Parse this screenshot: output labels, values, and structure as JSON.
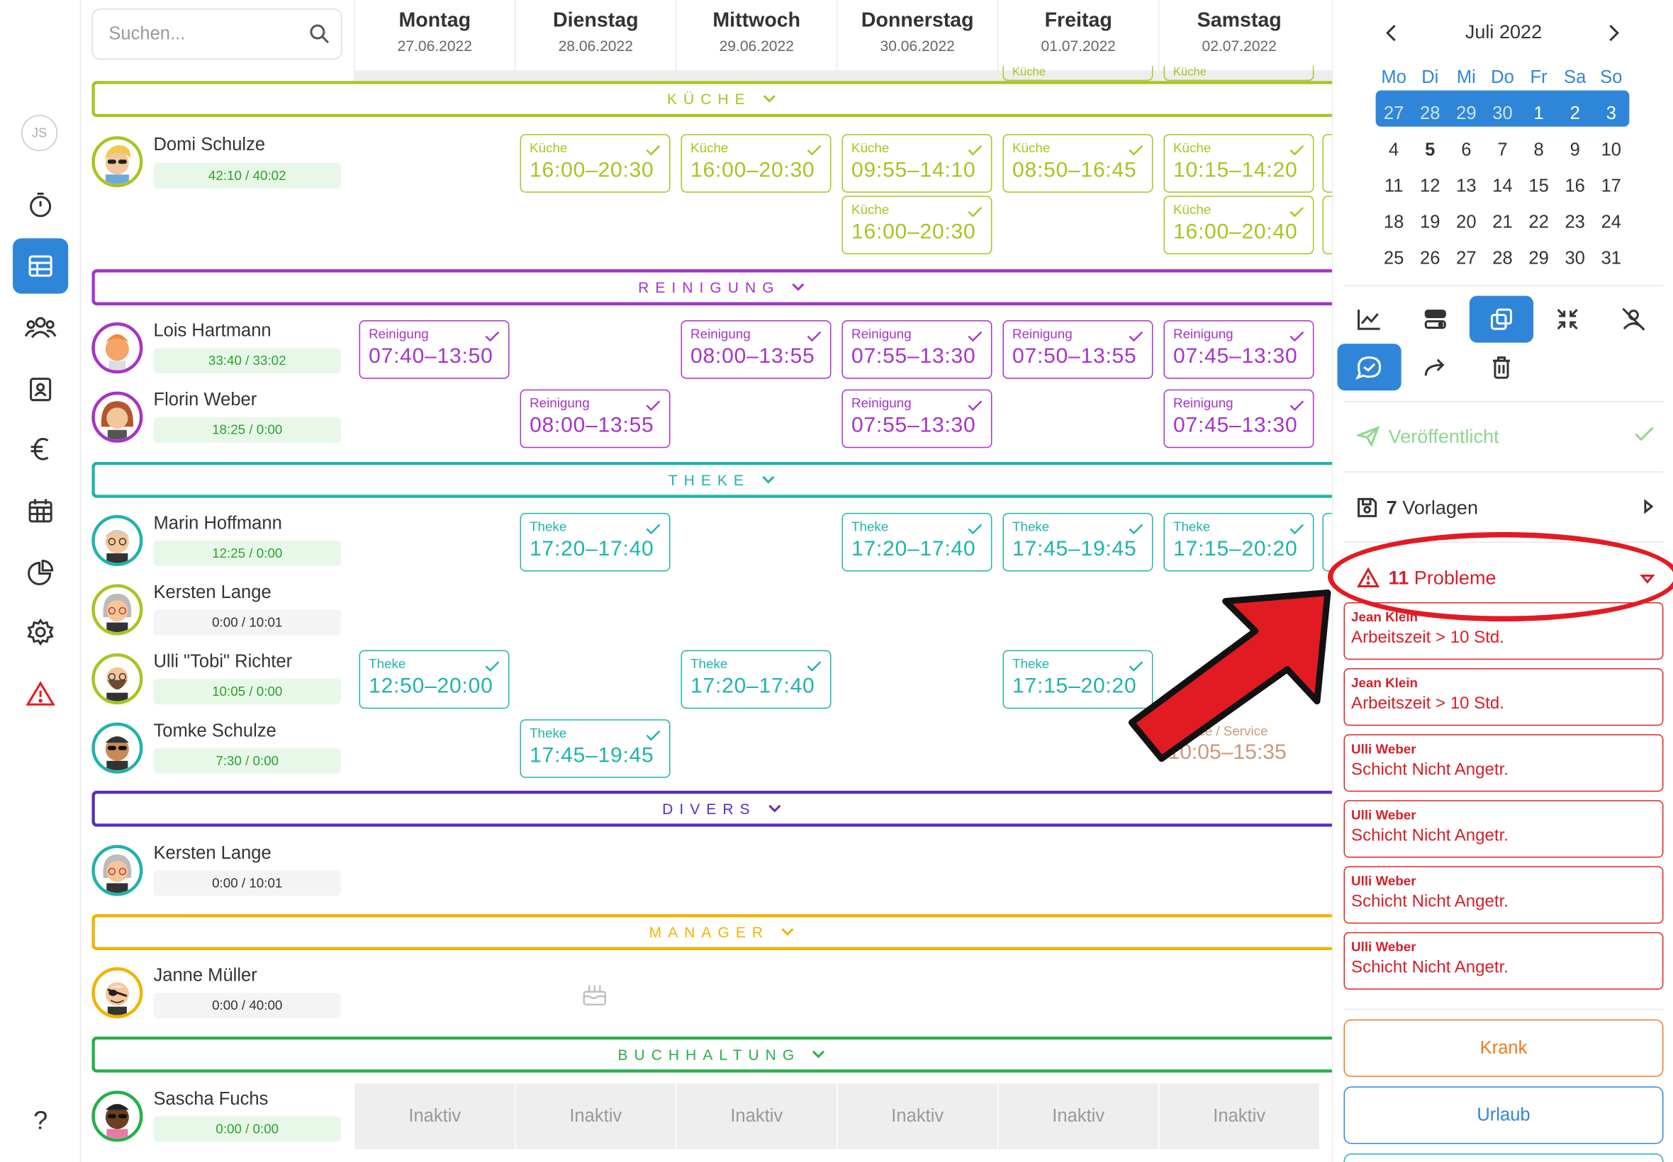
{
  "user": {
    "initials": "JS"
  },
  "search": {
    "placeholder": "Suchen..."
  },
  "days": [
    {
      "name": "Montag",
      "date": "27.06.2022"
    },
    {
      "name": "Dienstag",
      "date": "28.06.2022"
    },
    {
      "name": "Mittwoch",
      "date": "29.06.2022"
    },
    {
      "name": "Donnerstag",
      "date": "30.06.2022"
    },
    {
      "name": "Freitag",
      "date": "01.07.2022"
    },
    {
      "name": "Samstag",
      "date": "02.07.2022"
    }
  ],
  "groups": {
    "kueche": "KÜCHE",
    "reinigung": "REINIGUNG",
    "theke": "THEKE",
    "divers": "DIVERS",
    "manager": "MANAGER",
    "buchhaltung": "BUCHHALTUNG"
  },
  "colors": {
    "kueche": "#a7c520",
    "reinigung": "#a832c8",
    "theke": "#1fb3ac",
    "divers": "#5b2dbf",
    "manager": "#f0b400",
    "buchhaltung": "#24b04a",
    "accent": "#2f86d8",
    "danger": "#e21b23"
  },
  "employees": {
    "domi": {
      "name": "Domi Schulze",
      "hours": "42:10 / 40:02"
    },
    "lois": {
      "name": "Lois Hartmann",
      "hours": "33:40 / 33:02"
    },
    "florin": {
      "name": "Florin Weber",
      "hours": "18:25 / 0:00"
    },
    "marin": {
      "name": "Marin Hoffmann",
      "hours": "12:25 / 0:00"
    },
    "kersten": {
      "name": "Kersten Lange",
      "hours": "0:00 / 10:01"
    },
    "ulli": {
      "name": "Ulli \"Tobi\" Richter",
      "hours": "10:05 / 0:00"
    },
    "tomke": {
      "name": "Tomke Schulze",
      "hours": "7:30 / 0:00"
    },
    "kersten2": {
      "name": "Kersten Lange",
      "hours": "0:00 / 10:01"
    },
    "janne": {
      "name": "Janne Müller",
      "hours": "0:00 / 40:00"
    },
    "sascha": {
      "name": "Sascha Fuchs",
      "hours": "0:00 / 0:00"
    }
  },
  "shift_labels": {
    "kueche": "Küche",
    "reinigung": "Reinigung",
    "theke": "Theke",
    "service": "Service / Service"
  },
  "shifts": {
    "domi_d1": "16:00–20:30",
    "domi_d2": "16:00–20:30",
    "domi_d3a": "09:55–14:10",
    "domi_d3b": "16:00–20:30",
    "domi_d4": "08:50–16:45",
    "domi_d5a": "10:15–14:20",
    "domi_d5b": "16:00–20:40",
    "lois_d0": "07:40–13:50",
    "lois_d2": "08:00–13:55",
    "lois_d3": "07:55–13:30",
    "lois_d4": "07:50–13:55",
    "lois_d5": "07:45–13:30",
    "florin_d1": "08:00–13:55",
    "florin_d3": "07:55–13:30",
    "florin_d5": "07:45–13:30",
    "marin_d1": "17:20–17:40",
    "marin_d3": "17:20–17:40",
    "marin_d4": "17:45–19:45",
    "marin_d5": "17:15–20:20",
    "ulli_d0": "12:50–20:00",
    "ulli_d2": "17:20–17:40",
    "ulli_d4": "17:15–20:20",
    "tomke_d1": "17:45–19:45",
    "tomke_d5": "10:05–15:35"
  },
  "inaktiv": "Inaktiv",
  "calendar": {
    "month": "Juli 2022",
    "dow": [
      "Mo",
      "Di",
      "Mi",
      "Do",
      "Fr",
      "Sa",
      "So"
    ],
    "weeks": [
      [
        "27",
        "28",
        "29",
        "30",
        "1",
        "2",
        "3"
      ],
      [
        "4",
        "5",
        "6",
        "7",
        "8",
        "9",
        "10"
      ],
      [
        "11",
        "12",
        "13",
        "14",
        "15",
        "16",
        "17"
      ],
      [
        "18",
        "19",
        "20",
        "21",
        "22",
        "23",
        "24"
      ],
      [
        "25",
        "26",
        "27",
        "28",
        "29",
        "30",
        "31"
      ]
    ]
  },
  "panel": {
    "published": "Veröffentlicht",
    "templates_count": "7",
    "templates_label": "Vorlagen",
    "problems_count": "11",
    "problems_label": "Probleme",
    "problems": [
      {
        "name": "Jean Klein",
        "text": "Arbeitszeit > 10 Std."
      },
      {
        "name": "Jean Klein",
        "text": "Arbeitszeit > 10 Std."
      },
      {
        "name": "Ulli Weber",
        "text": "Schicht Nicht Angetr."
      },
      {
        "name": "Ulli Weber",
        "text": "Schicht Nicht Angetr."
      },
      {
        "name": "Ulli Weber",
        "text": "Schicht Nicht Angetr."
      },
      {
        "name": "Ulli Weber",
        "text": "Schicht Nicht Angetr."
      }
    ],
    "krank": "Krank",
    "urlaub": "Urlaub"
  },
  "icons": [
    "timer-icon",
    "table-icon",
    "team-icon",
    "contact-card-icon",
    "euro-icon",
    "calendar-icon",
    "pie-chart-icon",
    "gear-icon",
    "warning-icon",
    "help-icon"
  ]
}
